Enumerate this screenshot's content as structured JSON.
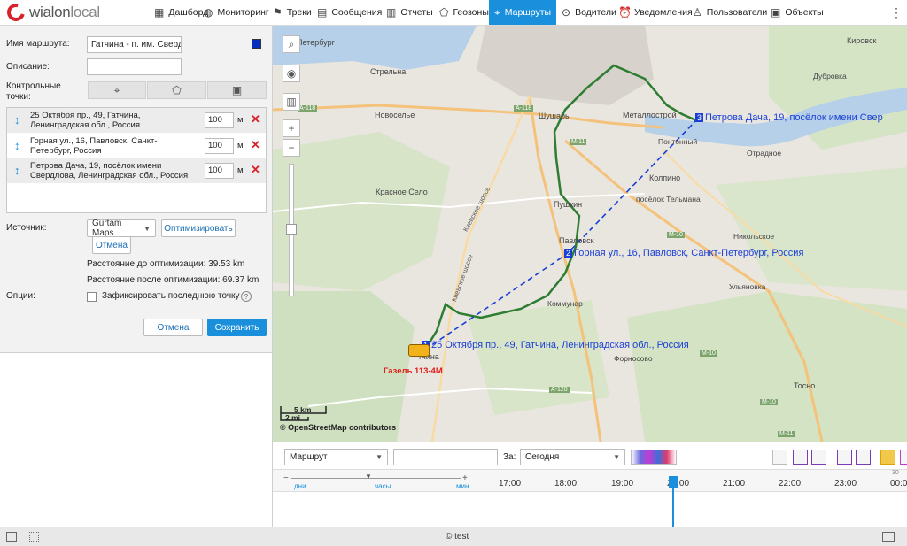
{
  "app": {
    "logo_text": "wialon",
    "logo_text2": "local"
  },
  "nav": [
    {
      "label": "Дашборд",
      "icon": "dashboard-icon",
      "glyph": "▦"
    },
    {
      "label": "Мониторинг",
      "icon": "globe-icon",
      "glyph": "◍"
    },
    {
      "label": "Треки",
      "icon": "flag-icon",
      "glyph": "⚑"
    },
    {
      "label": "Сообщения",
      "icon": "messages-icon",
      "glyph": "▤"
    },
    {
      "label": "Отчеты",
      "icon": "reports-icon",
      "glyph": "▥"
    },
    {
      "label": "Геозоны",
      "icon": "geofence-icon",
      "glyph": "⬠"
    },
    {
      "label": "Маршруты",
      "icon": "route-icon",
      "glyph": "⌖"
    },
    {
      "label": "Водители",
      "icon": "driver-icon",
      "glyph": "⊙"
    },
    {
      "label": "Уведомления",
      "icon": "alarm-icon",
      "glyph": "⏰"
    },
    {
      "label": "Пользователи",
      "icon": "user-icon",
      "glyph": "♙"
    },
    {
      "label": "Объекты",
      "icon": "bus-icon",
      "glyph": "▣"
    }
  ],
  "more_glyph": "⋮",
  "form": {
    "name_label": "Имя маршрута:",
    "name_value": "Гатчина - п. им. Сверд",
    "desc_label": "Описание:",
    "desc_value": "",
    "checkpoints_label": "Контрольные точки:",
    "route_color": "#0a2fbf",
    "point_types": [
      {
        "icon": "map-pin-icon",
        "glyph": "⌖"
      },
      {
        "icon": "polygon-icon",
        "glyph": "⬠"
      },
      {
        "icon": "bus-stop-icon",
        "glyph": "▣"
      }
    ],
    "points": [
      {
        "address": "25 Октября пр., 49, Гатчина, Ленинградская обл., Россия",
        "radius": "100",
        "unit": "м"
      },
      {
        "address": "Горная ул., 16, Павловск, Санкт-Петербург, Россия",
        "radius": "100",
        "unit": "м"
      },
      {
        "address": "Петрова Дача, 19, посёлок имени Свердлова, Ленинградская обл., Россия",
        "radius": "100",
        "unit": "м"
      }
    ],
    "source_label": "Источник:",
    "source_value": "Gurtam Maps",
    "optimize_button": "Оптимизировать",
    "cancel_opt_button": "Отмена",
    "dist_before": "Расстояние до оптимизации: 39.53 km",
    "dist_after": "Расстояние после оптимизации: 69.37 km",
    "options_label": "Опции:",
    "fix_last_label": "Зафиксировать последнюю точку",
    "cancel_button": "Отмена",
    "save_button": "Сохранить"
  },
  "map": {
    "labels": {
      "spb": "Петербург",
      "strelna": "Стрельна",
      "novoselye": "Новоселье",
      "shushary": "Шушары",
      "metallostroy": "Металлострой",
      "pontonny": "Понтонный",
      "otradnoe": "Отрадное",
      "kolpino": "Колпино",
      "telmana": "посёлок Тельмана",
      "krasnoe_selo": "Красное Село",
      "pushkin": "Пушкин",
      "pavlovsk": "Павловск",
      "nikolskoe": "Никольское",
      "ulyanovka": "Ульяновка",
      "kommunar": "Коммунар",
      "fornosovo": "Форносово",
      "tosno": "Тосно",
      "kirovsk": "Кировск",
      "dubrovka": "Дубровка",
      "gatchina": "тчина"
    },
    "roads": {
      "a118": "A-118",
      "a118b": "A-118",
      "m11": "M-11",
      "m11b": "M-11",
      "m11c": "M-11",
      "m10": "M-10",
      "m10b": "M-10",
      "a120": "A-120",
      "kiev": "Киевское шоссе",
      "kiev2": "Киевское шоссе",
      "m10c": "M-10"
    },
    "markers": [
      {
        "num": "1",
        "label": "25 Октября пр., 49, Гатчина, Ленинградская обл., Россия"
      },
      {
        "num": "2",
        "label": "Горная ул., 16, Павловск, Санкт-Петербург, Россия"
      },
      {
        "num": "3",
        "label": "Петрова Дача, 19, посёлок имени Свер"
      }
    ],
    "unit_label": "Газель 113-4М",
    "scale_km": "5 km",
    "scale_mi": "2 mi",
    "attribution": "© OpenStreetMap contributors",
    "controls": [
      "search-icon",
      "eye-icon",
      "layers-icon",
      "zoom-in-icon",
      "zoom-out-icon"
    ],
    "control_glyphs": {
      "search": "⌕",
      "eye": "◉",
      "layers": "▥",
      "zoom_in": "+",
      "zoom_out": "−"
    }
  },
  "timeline": {
    "type_select": "Маршрут",
    "search_value": "",
    "period_label": "За:",
    "period_value": "Сегодня",
    "scale_labels": {
      "days": "дни",
      "hours": "часы",
      "minutes": "мин.",
      "minus": "−",
      "plus": "+"
    },
    "hours": [
      "17:00",
      "18:00",
      "19:00",
      "20:00",
      "21:00",
      "22:00",
      "23:00",
      "00:00"
    ],
    "next_day": "30"
  },
  "status": {
    "copyright": "© test"
  }
}
